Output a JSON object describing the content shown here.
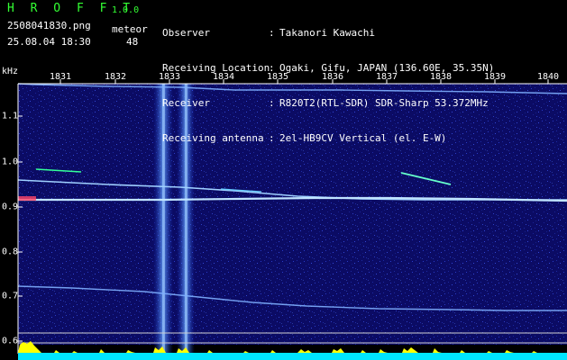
{
  "app": {
    "name": "H R O F F T",
    "version": "1.0.0"
  },
  "file": {
    "name": "2508041830.png",
    "datetime": "25.08.04 18:30"
  },
  "meteor": {
    "label": "meteor",
    "count": "48"
  },
  "info": [
    {
      "label": "Observer",
      "value": "Takanori Kawachi"
    },
    {
      "label": "Receiving Location",
      "value": "Ogaki, Gifu, JAPAN (136.60E, 35.35N)"
    },
    {
      "label": "Receiver",
      "value": "R820T2(RTL-SDR) SDR-Sharp 53.372MHz"
    },
    {
      "label": "Receiving antenna",
      "value": "2el-HB9CV Vertical (el. E-W)"
    }
  ],
  "spectrogram": {
    "y_unit": "kHz",
    "x_ticks": [
      "1831",
      "1832",
      "1833",
      "1834",
      "1835",
      "1836",
      "1837",
      "1838",
      "1839",
      "1840"
    ],
    "y_ticks": [
      "1.1",
      "1.0",
      "0.9",
      "0.8",
      "0.7",
      "0.6"
    ],
    "colors": {
      "background": "#0a0a5a",
      "trace": "#9fd0ff",
      "axis": "#ffffff",
      "text_green": "#33ff33",
      "histogram": "#ffff00",
      "histogram_base": "#00ffff"
    }
  }
}
